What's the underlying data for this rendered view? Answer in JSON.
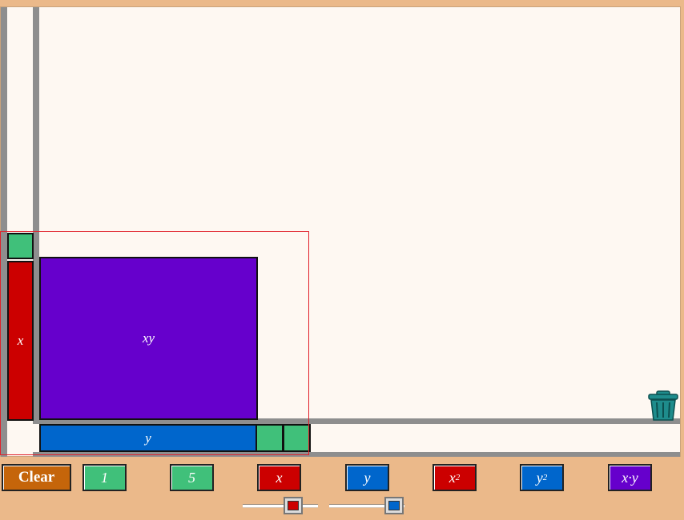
{
  "workspace": {
    "tiles": {
      "x_label": "x",
      "xy_label": "xy",
      "y_label": "y"
    }
  },
  "toolbar": {
    "clear_label": "Clear",
    "one_label": "1",
    "five_label": "5",
    "x_label": "x",
    "y_label": "y",
    "x2_base": "x",
    "x2_exp": "2",
    "y2_base": "y",
    "y2_exp": "2",
    "xy_label": "x·y"
  },
  "sliders": {
    "x_color": "#CC0000",
    "y_color": "#0066CC"
  },
  "colors": {
    "unit": "#40C07A",
    "x": "#CC0000",
    "y": "#0066CC",
    "xy": "#6600CC",
    "clear": "#C5650A",
    "trash": "#1E8C8C"
  },
  "icons": {
    "trash": "trash-can-icon"
  }
}
